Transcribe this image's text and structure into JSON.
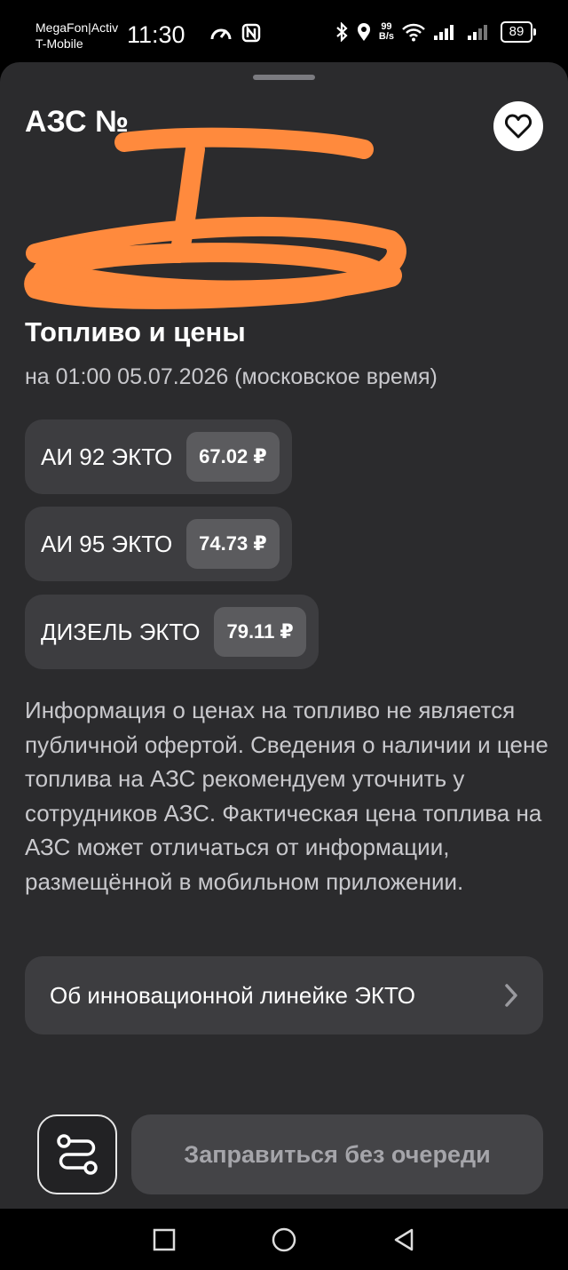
{
  "status_bar": {
    "carrier_1": "MegaFon|Activ",
    "carrier_2": "T-Mobile",
    "time": "11:30",
    "net_speed_value": "99",
    "net_speed_unit": "B/s",
    "battery": "89",
    "icons": [
      "speedometer-icon",
      "nfc-icon",
      "bluetooth-icon",
      "location-icon",
      "wifi-icon",
      "signal-icon"
    ]
  },
  "station": {
    "title": "АЗС №"
  },
  "prices": {
    "title": "Топливо и цены",
    "subtitle": "на 01:00 05.07.2026 (московское время)",
    "fuels": [
      {
        "name": "АИ 92 ЭКТО",
        "price": "67.02 ₽"
      },
      {
        "name": "АИ 95 ЭКТО",
        "price": "74.73 ₽"
      },
      {
        "name": "ДИЗЕЛЬ ЭКТО",
        "price": "79.11 ₽"
      }
    ],
    "disclaimer": "Информация о ценах на топливо не является публичной офертой. Сведения о наличии и цене топлива на АЗС рекомендуем уточнить у сотрудников АЗС. Фактическая цена топлива на АЗС может отличаться от информации, размещённой в мобильном приложении."
  },
  "links": {
    "ecto_line": "Об инновационной линейке ЭКТО"
  },
  "actions": {
    "fuel_no_queue": "Заправиться без очереди"
  },
  "colors": {
    "sheet_bg": "#2b2b2d",
    "card_bg": "#3d3d40",
    "price_pill": "#5b5b5e",
    "redaction": "#ff8a3d"
  }
}
